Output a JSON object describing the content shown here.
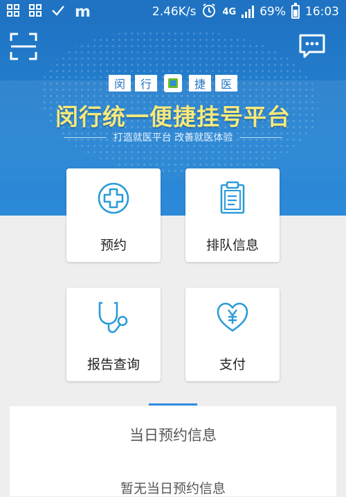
{
  "status_bar": {
    "net_speed": "2.46K/s",
    "network": "4G",
    "battery": "69%",
    "battery_level": 0.69,
    "time": "16:03",
    "icons": [
      "grid-icon",
      "grid-icon",
      "check-icon",
      "m-app-icon",
      "alarm-icon",
      "signal-icon",
      "battery-icon"
    ]
  },
  "header": {
    "brand_chars": [
      "闵",
      "行",
      "捷",
      "医"
    ],
    "title": "闵行统一便捷挂号平台",
    "subtitle": "打造就医平台 改善就医体验",
    "colors": {
      "primary": "#1f74c4",
      "title": "#f7e97a",
      "accent": "#2f8ee0"
    }
  },
  "menu": [
    {
      "label": "预约",
      "icon": "medical-cross-icon"
    },
    {
      "label": "排队信息",
      "icon": "clipboard-icon"
    },
    {
      "label": "报告查询",
      "icon": "stethoscope-icon"
    },
    {
      "label": "支付",
      "icon": "heart-yen-icon"
    }
  ],
  "info": {
    "title": "当日预约信息",
    "empty_text": "暂无当日预约信息"
  }
}
